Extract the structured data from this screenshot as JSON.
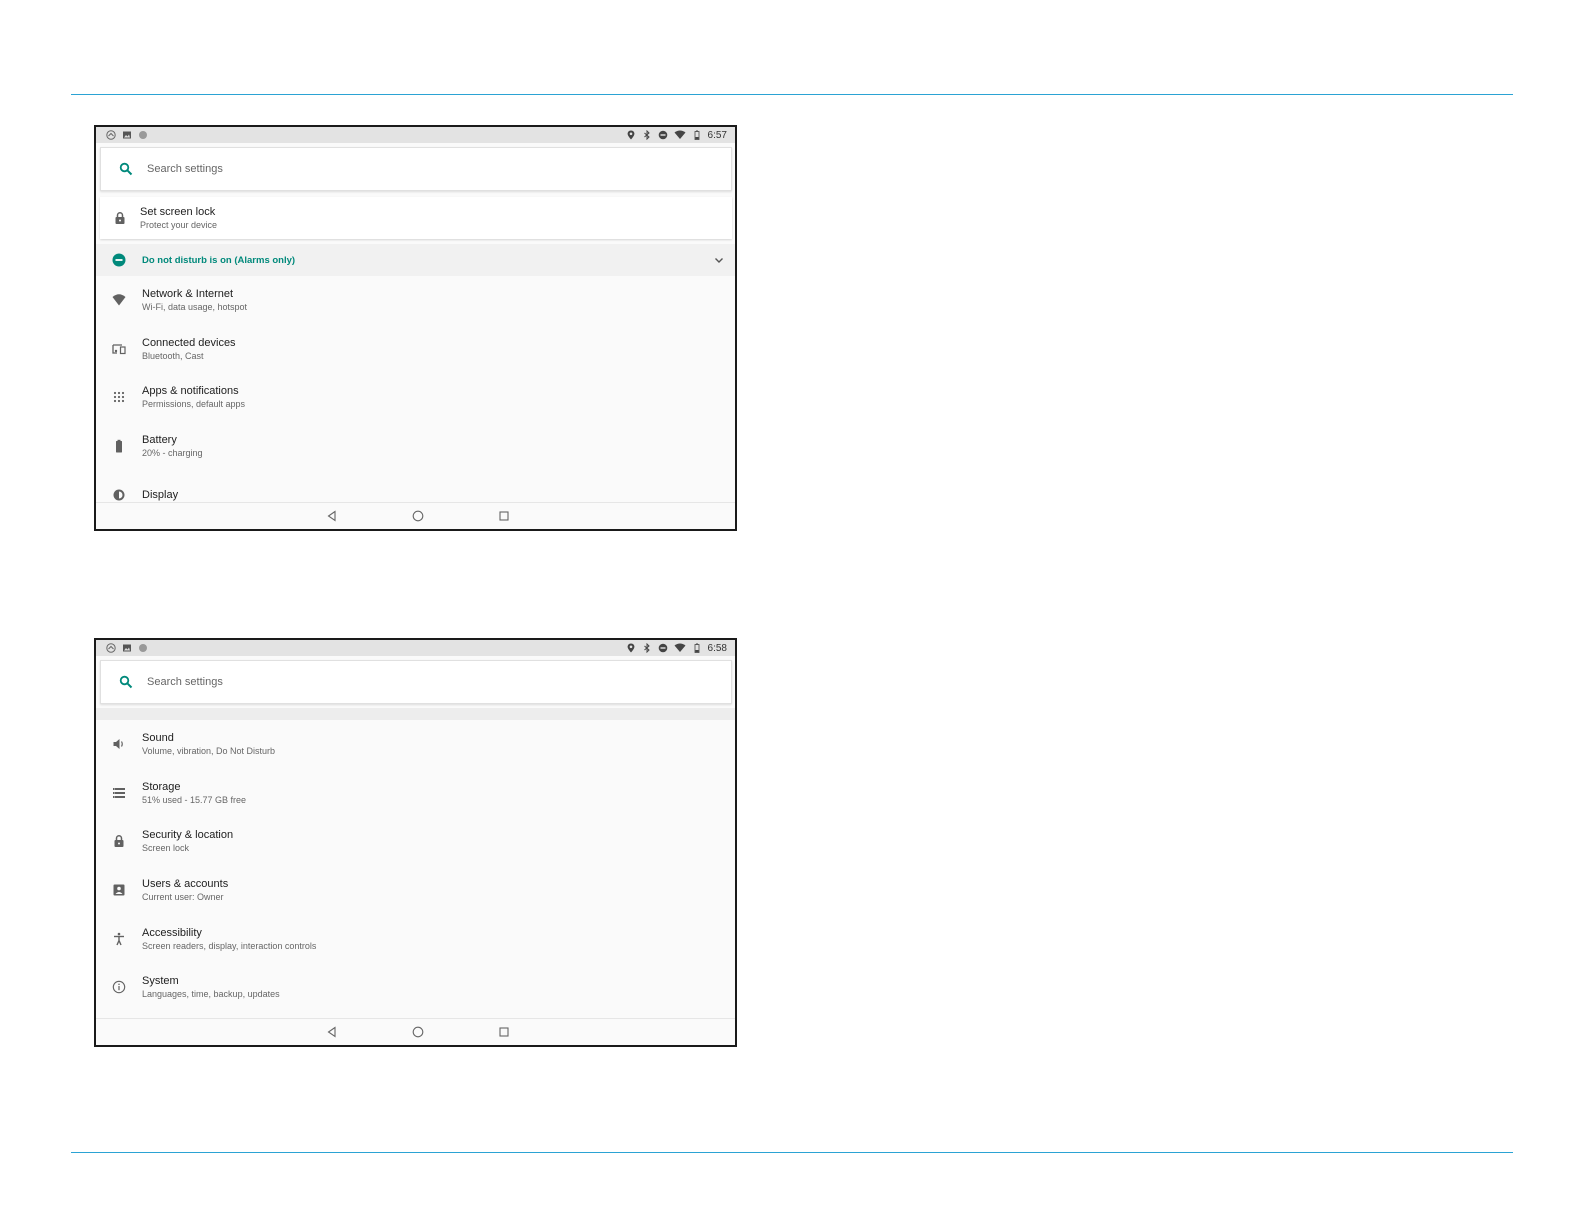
{
  "screens": [
    {
      "status": {
        "time": "6:57"
      },
      "search": {
        "placeholder": "Search settings"
      },
      "suggestion": {
        "title": "Set screen lock",
        "subtitle": "Protect your device",
        "icon": "lock-icon"
      },
      "dnd": {
        "text": "Do not disturb is on (Alarms only)",
        "icon": "do-not-disturb-icon"
      },
      "items": [
        {
          "title": "Network & Internet",
          "subtitle": "Wi-Fi, data usage, hotspot",
          "icon": "wifi-icon"
        },
        {
          "title": "Connected devices",
          "subtitle": "Bluetooth, Cast",
          "icon": "devices-icon"
        },
        {
          "title": "Apps & notifications",
          "subtitle": "Permissions, default apps",
          "icon": "apps-grid-icon"
        },
        {
          "title": "Battery",
          "subtitle": "20% - charging",
          "icon": "battery-icon"
        },
        {
          "title": "Display",
          "subtitle": "",
          "icon": "brightness-icon"
        }
      ]
    },
    {
      "status": {
        "time": "6:58"
      },
      "search": {
        "placeholder": "Search settings"
      },
      "items": [
        {
          "title": "Sound",
          "subtitle": "Volume, vibration, Do Not Disturb",
          "icon": "volume-icon"
        },
        {
          "title": "Storage",
          "subtitle": "51% used - 15.77 GB free",
          "icon": "storage-icon"
        },
        {
          "title": "Security & location",
          "subtitle": "Screen lock",
          "icon": "lock-icon"
        },
        {
          "title": "Users & accounts",
          "subtitle": "Current user: Owner",
          "icon": "account-box-icon"
        },
        {
          "title": "Accessibility",
          "subtitle": "Screen readers, display, interaction controls",
          "icon": "accessibility-icon"
        },
        {
          "title": "System",
          "subtitle": "Languages, time, backup, updates",
          "icon": "info-icon"
        }
      ]
    }
  ],
  "colors": {
    "accent": "#00897b",
    "rule": "#2ba3d4",
    "icon": "#616161"
  }
}
